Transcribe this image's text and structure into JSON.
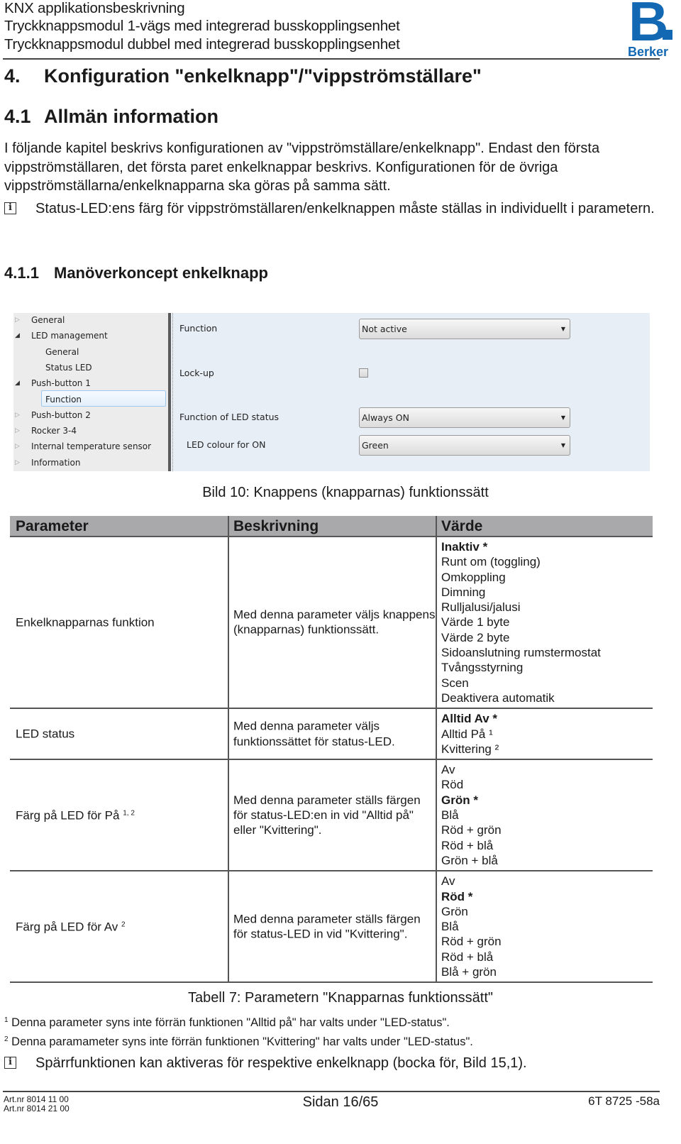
{
  "header": {
    "title": "KNX applikationsbeskrivning",
    "subtitle1": "Tryckknappsmodul 1-vägs med integrerad busskopplingsenhet",
    "subtitle2": "Tryckknappsmodul dubbel med integrerad busskopplingsenhet",
    "logo_letter": "B",
    "logo_word": "Berker",
    "brand_color": "#1268b3"
  },
  "section": {
    "h1_num": "4.",
    "h1_text": "Konfiguration \"enkelknapp\"/\"vippströmställare\"",
    "h2_num": "4.1",
    "h2_text": "Allmän information",
    "paragraph": "I följande kapitel beskrivs konfigurationen av \"vippströmställare/enkelknapp\". Endast den första vippströmställaren, det första paret enkelknappar beskrivs. Konfigurationen för de övriga vippströmställarna/enkelknapparna ska göras på samma sätt.",
    "note1": "Status-LED:ens färg för vippströmställaren/enkelknappen måste ställas in individuellt i parametern.",
    "note_icon": "i",
    "h3_num": "4.1.1",
    "h3_text": "Manöverkoncept enkelknapp"
  },
  "screenshot": {
    "tree": [
      {
        "label": "General",
        "arrow": "collapsed",
        "level": 0
      },
      {
        "label": "LED management",
        "arrow": "expanded",
        "level": 0
      },
      {
        "label": "General",
        "arrow": "none",
        "level": 1
      },
      {
        "label": "Status LED",
        "arrow": "none",
        "level": 1
      },
      {
        "label": "Push-button 1",
        "arrow": "expanded",
        "level": 0
      },
      {
        "label": "Function",
        "arrow": "none",
        "level": 1,
        "selected": true
      },
      {
        "label": "Push-button 2",
        "arrow": "collapsed",
        "level": 0
      },
      {
        "label": "Rocker 3-4",
        "arrow": "collapsed",
        "level": 0
      },
      {
        "label": "Internal temperature sensor",
        "arrow": "collapsed",
        "level": 0
      },
      {
        "label": "Information",
        "arrow": "collapsed",
        "level": 0
      }
    ],
    "fields": {
      "function_label": "Function",
      "function_value": "Not active",
      "lockup_label": "Lock-up",
      "lockup_checked": false,
      "led_status_label": "Function of LED status",
      "led_status_value": "Always ON",
      "led_colour_label": "LED colour for ON",
      "led_colour_value": "Green"
    }
  },
  "figure_caption": "Bild 10:  Knappens (knapparnas) funktionssätt",
  "table": {
    "headers": [
      "Parameter",
      "Beskrivning",
      "Värde"
    ],
    "rows": [
      {
        "param": "Enkelknapparnas funktion",
        "param_sup": "",
        "desc": "Med denna parameter väljs knappens (knapparnas) funktionssätt.",
        "values": [
          {
            "text": "Inaktiv *",
            "bold": true
          },
          {
            "text": "Runt om (toggling)",
            "bold": false
          },
          {
            "text": "Omkoppling",
            "bold": false
          },
          {
            "text": "Dimning",
            "bold": false
          },
          {
            "text": "Rulljalusi/jalusi",
            "bold": false
          },
          {
            "text": "Värde 1 byte",
            "bold": false
          },
          {
            "text": "Värde 2 byte",
            "bold": false
          },
          {
            "text": "Sidoanslutning rumstermostat",
            "bold": false
          },
          {
            "text": "Tvångsstyrning",
            "bold": false
          },
          {
            "text": "Scen",
            "bold": false
          },
          {
            "text": "Deaktivera automatik",
            "bold": false
          }
        ]
      },
      {
        "param": "LED status",
        "param_sup": "",
        "desc": "Med denna parameter väljs funktionssättet för status-LED.",
        "values": [
          {
            "text": "Alltid Av *",
            "bold": true
          },
          {
            "text": "Alltid På ¹",
            "bold": false
          },
          {
            "text": "Kvittering ²",
            "bold": false
          }
        ]
      },
      {
        "param": "Färg på LED för På",
        "param_sup": "1, 2",
        "desc": "Med denna parameter ställs färgen för status-LED:en in vid \"Alltid på\" eller \"Kvittering\".",
        "values": [
          {
            "text": "Av",
            "bold": false
          },
          {
            "text": "Röd",
            "bold": false
          },
          {
            "text": "Grön *",
            "bold": true
          },
          {
            "text": "Blå",
            "bold": false
          },
          {
            "text": "Röd + grön",
            "bold": false
          },
          {
            "text": "Röd + blå",
            "bold": false
          },
          {
            "text": "Grön + blå",
            "bold": false
          }
        ]
      },
      {
        "param": "Färg på LED för Av",
        "param_sup": "2",
        "desc": "Med denna parameter ställs färgen för status-LED in vid \"Kvittering\".",
        "values": [
          {
            "text": "Av",
            "bold": false
          },
          {
            "text": "Röd *",
            "bold": true
          },
          {
            "text": "Grön",
            "bold": false
          },
          {
            "text": "Blå",
            "bold": false
          },
          {
            "text": "Röd + grön",
            "bold": false
          },
          {
            "text": "Röd + blå",
            "bold": false
          },
          {
            "text": "Blå + grön",
            "bold": false
          }
        ]
      }
    ]
  },
  "table_caption": "Tabell 7:  Parametern \"Knapparnas funktionssätt\"",
  "footnotes": [
    {
      "mark": "1",
      "text": " Denna parameter syns inte förrän funktionen \"Alltid på\" har valts under \"LED-status\"."
    },
    {
      "mark": "2",
      "text": " Denna paramameter syns inte förrän funktionen \"Kvittering\" har valts under \"LED-status\"."
    }
  ],
  "note2": "Spärrfunktionen kan aktiveras för respektive enkelknapp (bocka för, Bild 15,1).",
  "footer": {
    "art1": "Art.nr 8014 11 00",
    "art2": "Art.nr 8014 21 00",
    "page": "Sidan 16/65",
    "doc": "6T 8725 -58a"
  }
}
